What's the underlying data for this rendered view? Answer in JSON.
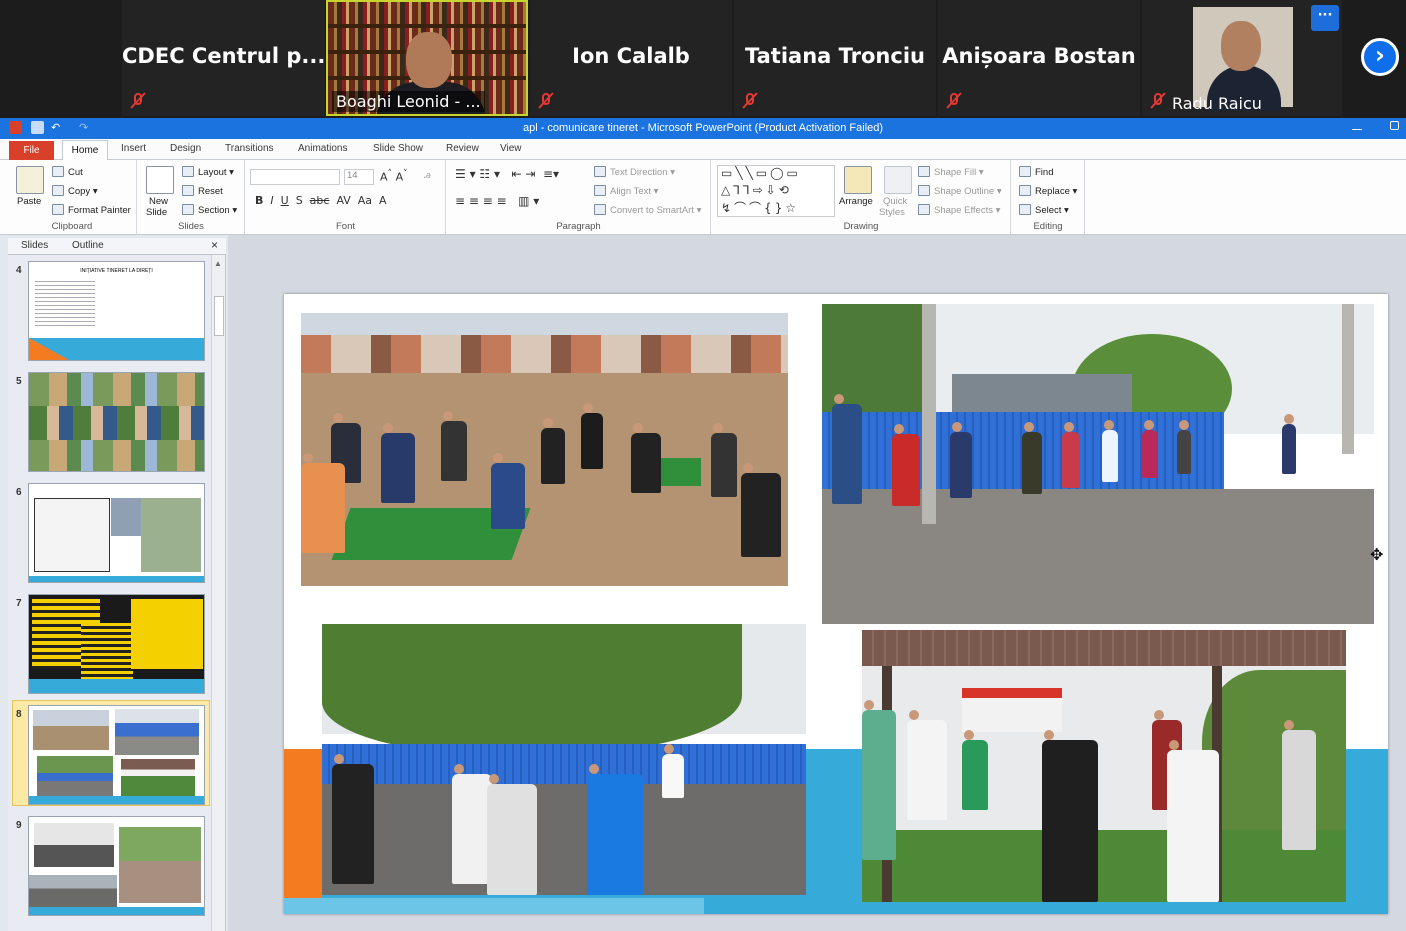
{
  "meeting": {
    "tiles": [
      {
        "name": "CDEC Centrul p..."
      },
      {
        "label": "Boaghi Leonid - ..."
      },
      {
        "name": "Ion Calalb"
      },
      {
        "name": "Tatiana Tronciu"
      },
      {
        "name": "Anișoara Bostan"
      },
      {
        "label": "Radu Raicu"
      }
    ],
    "more_button": "···",
    "next_button": "›"
  },
  "window": {
    "title": "apl - comunicare tineret  -  Microsoft PowerPoint (Product Activation Failed)"
  },
  "tabs": [
    "File",
    "Home",
    "Insert",
    "Design",
    "Transitions",
    "Animations",
    "Slide Show",
    "Review",
    "View"
  ],
  "ribbon": {
    "clipboard": {
      "paste": "Paste",
      "cut": "Cut",
      "copy": "Copy",
      "format_painter": "Format Painter",
      "group": "Clipboard"
    },
    "slides": {
      "new_slide_1": "New",
      "new_slide_2": "Slide",
      "layout": "Layout",
      "reset": "Reset",
      "section": "Section",
      "group": "Slides"
    },
    "font": {
      "size": "14",
      "group": "Font"
    },
    "paragraph": {
      "text_direction": "Text Direction",
      "align_text": "Align Text",
      "convert": "Convert to SmartArt",
      "group": "Paragraph"
    },
    "drawing": {
      "arrange": "Arrange",
      "quick_styles_1": "Quick",
      "quick_styles_2": "Styles",
      "shape_fill": "Shape Fill",
      "shape_outline": "Shape Outline",
      "shape_effects": "Shape Effects",
      "group": "Drawing"
    },
    "editing": {
      "find": "Find",
      "replace": "Replace",
      "select": "Select",
      "group": "Editing"
    }
  },
  "panel": {
    "tab_slides": "Slides",
    "tab_outline": "Outline",
    "close": "×",
    "thumbs": [
      {
        "num": "4",
        "title": "INIȚIATIVE TINERET LA DIREȚI"
      },
      {
        "num": "5"
      },
      {
        "num": "6"
      },
      {
        "num": "7"
      },
      {
        "num": "8"
      },
      {
        "num": "9"
      }
    ]
  },
  "colors": {
    "accent_blue": "#36abd9",
    "accent_orange": "#f47b20",
    "zoom_blue": "#0e6eeb",
    "ppt_title": "#1b73e0",
    "file_tab": "#d8402a",
    "speaker_border": "#c8d430"
  }
}
